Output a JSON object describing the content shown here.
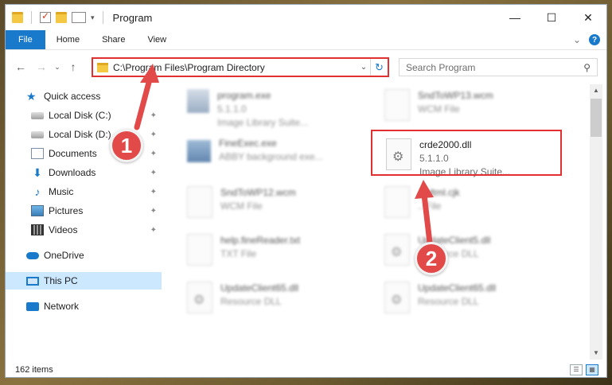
{
  "window": {
    "title": "Program",
    "controls": [
      "—",
      "☐",
      "✕"
    ]
  },
  "ribbon": {
    "tabs": [
      "File",
      "Home",
      "Share",
      "View"
    ],
    "collapse_glyph": "⌄",
    "help_glyph": "?"
  },
  "address": {
    "path": "C:\\Program Files\\Program Directory",
    "dropdown_glyph": "⌄",
    "refresh_glyph": "↻"
  },
  "search": {
    "placeholder": "Search Program",
    "icon": "search-icon",
    "glyph": "⚲"
  },
  "nav": {
    "back_glyph": "←",
    "forward_glyph": "→",
    "recent_glyph": "⌄",
    "up_glyph": "↑"
  },
  "sidebar": {
    "items": [
      {
        "label": "Quick access",
        "icon": "star-icon",
        "pinned": false
      },
      {
        "label": "Local Disk (C:)",
        "icon": "disk-icon",
        "pinned": true
      },
      {
        "label": "Local Disk (D:)",
        "icon": "disk-icon",
        "pinned": true
      },
      {
        "label": "Documents",
        "icon": "documents-icon",
        "pinned": true
      },
      {
        "label": "Downloads",
        "icon": "downloads-icon",
        "pinned": true
      },
      {
        "label": "Music",
        "icon": "music-icon",
        "pinned": true
      },
      {
        "label": "Pictures",
        "icon": "pictures-icon",
        "pinned": true
      },
      {
        "label": "Videos",
        "icon": "videos-icon",
        "pinned": true
      },
      {
        "label": "OneDrive",
        "icon": "onedrive-icon",
        "pinned": false
      },
      {
        "label": "This PC",
        "icon": "this-pc-icon",
        "pinned": false,
        "selected": true
      },
      {
        "label": "Network",
        "icon": "network-icon",
        "pinned": false
      }
    ],
    "pin_glyph": "📌"
  },
  "files": [
    {
      "name": "program.exe",
      "line2": "5.1.1.0",
      "line3": "Image Library Suite..."
    },
    {
      "name": "SndToWP13.wcm",
      "line2": "WCM File",
      "line3": ""
    },
    {
      "name": "FineExec.exe",
      "line2": "ABBY background exe...",
      "line3": ""
    },
    {
      "name": "crde2000.dll",
      "line2": "5.1.1.0",
      "line3": "Image Library Suite..."
    },
    {
      "name": "SndToWP12.wcm",
      "line2": "WCM File",
      "line3": ""
    },
    {
      "name": "...Html.cjk",
      "line2": "...File",
      "line3": ""
    },
    {
      "name": "help.fineReader.txt",
      "line2": "TXT File",
      "line3": ""
    },
    {
      "name": "UpdateClient5.dll",
      "line2": "Resource DLL",
      "line3": ""
    },
    {
      "name": "UpdateClient65.dll",
      "line2": "Resource DLL",
      "line3": ""
    },
    {
      "name": "UpdateClient65.dll",
      "line2": "Resource DLL",
      "line3": ""
    }
  ],
  "status": {
    "item_count": "162 items"
  },
  "callouts": [
    "1",
    "2"
  ],
  "colors": {
    "accent": "#1979ca",
    "callout": "#e24a4a",
    "highlight_border": "#e03030",
    "selected_bg": "#cce8ff"
  }
}
